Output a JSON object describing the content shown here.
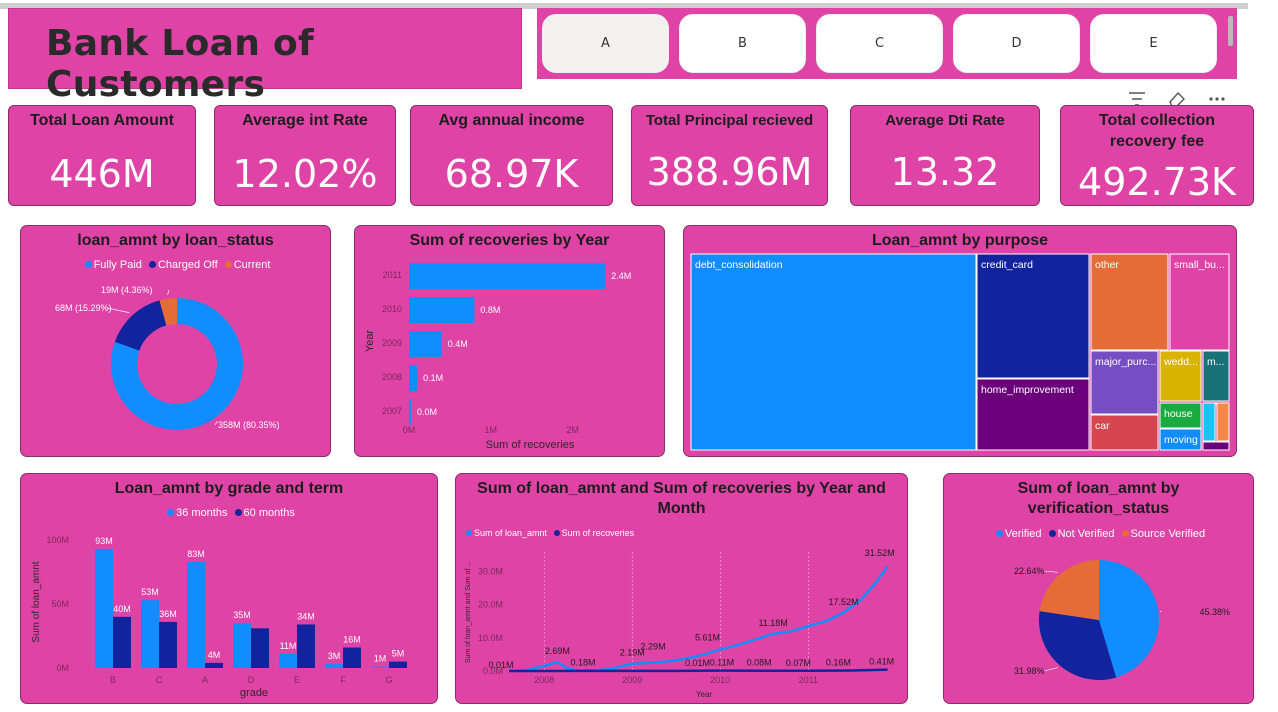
{
  "header": {
    "title": "Bank Loan of  Customers"
  },
  "slicer": {
    "items": [
      "A",
      "B",
      "C",
      "D",
      "E"
    ],
    "selected": "A"
  },
  "toolbar": {
    "icons": [
      "filter-icon",
      "eraser-icon",
      "more-icon"
    ]
  },
  "kpis": [
    {
      "label": "Total Loan Amount",
      "value": "446M"
    },
    {
      "label": "Average int Rate",
      "value": "12.02%"
    },
    {
      "label": "Avg annual income",
      "value": "68.97K"
    },
    {
      "label": "Total Principal recieved",
      "value": "388.96M"
    },
    {
      "label": "Average Dti Rate",
      "value": "13.32"
    },
    {
      "label": "Total collection recovery fee",
      "value": "492.73K"
    }
  ],
  "colors": {
    "background": "#df43a5",
    "blue": "#118dff",
    "navy": "#12239e",
    "red": "#e66c37",
    "pink_card": "#df43a5"
  },
  "chart_data": [
    {
      "type": "pie",
      "title": "loan_amnt by loan_status",
      "labels": [
        "Fully Paid",
        "Charged Off",
        "Current"
      ],
      "values": [
        358,
        68,
        19
      ],
      "data_labels": [
        "358M (80.35%)",
        "68M (15.29%)",
        "19M (4.36%)"
      ],
      "colors": [
        "#118dff",
        "#12239e",
        "#e66c37"
      ],
      "legend_position": "top"
    },
    {
      "type": "bar",
      "title": "Sum of recoveries by Year",
      "categories": [
        "2011",
        "2010",
        "2009",
        "2008",
        "2007"
      ],
      "values": [
        2.4,
        0.8,
        0.4,
        0.1,
        0.0
      ],
      "data_labels": [
        "2.4M",
        "0.8M",
        "0.4M",
        "0.1M",
        "0.0M"
      ],
      "xlabel": "Sum of recoveries",
      "ylabel": "Year",
      "xticks": [
        "0M",
        "1M",
        "2M"
      ],
      "xlim": [
        0,
        2.8
      ],
      "orientation": "horizontal"
    },
    {
      "type": "heatmap",
      "title": "Loan_amnt by purpose",
      "cells": [
        {
          "label": "debt_consolidation",
          "color": "#118dff"
        },
        {
          "label": "credit_card",
          "color": "#12239e"
        },
        {
          "label": "home_improvement",
          "color": "#6b007b"
        },
        {
          "label": "other",
          "color": "#e66c37"
        },
        {
          "label": "small_bu...",
          "color": "#df43a5"
        },
        {
          "label": "major_purc...",
          "color": "#744ec2"
        },
        {
          "label": "wedd...",
          "color": "#d9b300"
        },
        {
          "label": "m...",
          "color": "#197278"
        },
        {
          "label": "car",
          "color": "#d64550"
        },
        {
          "label": "house",
          "color": "#1aab40"
        },
        {
          "label": "moving",
          "color": "#118dff"
        },
        {
          "label": "",
          "color": "#15c6f4"
        },
        {
          "label": "",
          "color": "#f48846"
        },
        {
          "label": "",
          "color": "#6b007b"
        },
        {
          "label": "",
          "color": "#f5d33f"
        }
      ]
    },
    {
      "type": "bar",
      "title": "Loan_amnt by grade and term",
      "categories": [
        "B",
        "C",
        "A",
        "D",
        "E",
        "F",
        "G"
      ],
      "series": [
        {
          "name": "36 months",
          "values": [
            93,
            53,
            83,
            35,
            11,
            3,
            1
          ],
          "labels": [
            "93M",
            "53M",
            "83M",
            "35M",
            "11M",
            "3M",
            "1M"
          ]
        },
        {
          "name": "60 months",
          "values": [
            40,
            36,
            4,
            31,
            34,
            16,
            5
          ],
          "labels": [
            "40M",
            "36M",
            "4M",
            "",
            "34M",
            "16M",
            "5M"
          ]
        }
      ],
      "xlabel": "grade",
      "ylabel": "Sum of loan_amnt",
      "yticks": [
        "0M",
        "50M",
        "100M"
      ],
      "ylim": [
        0,
        100
      ]
    },
    {
      "type": "line",
      "title": "Sum of loan_amnt and Sum of recoveries by Year and Month",
      "xlabel": "Year",
      "ylabel": "Sum of loan_amnt and Sum of ...",
      "xticks": [
        "2008",
        "2009",
        "2010",
        "2011"
      ],
      "yticks": [
        "0.0M",
        "10.0M",
        "20.0M",
        "30.0M"
      ],
      "ylim": [
        0,
        34
      ],
      "series": [
        {
          "name": "Sum of loan_amnt",
          "color": "#118dff",
          "x": [
            2007.6,
            2007.8,
            2008.0,
            2008.15,
            2008.25,
            2008.35,
            2008.6,
            2008.8,
            2009.0,
            2009.1,
            2009.3,
            2009.5,
            2009.7,
            2009.9,
            2010.0,
            2010.2,
            2010.4,
            2010.6,
            2010.8,
            2011.0,
            2011.2,
            2011.4,
            2011.6,
            2011.75,
            2011.9
          ],
          "y": [
            0.01,
            0.3,
            1.5,
            2.69,
            1.0,
            0.2,
            0.18,
            0.9,
            2.19,
            2.29,
            2.6,
            3.2,
            4.2,
            5.61,
            6.5,
            7.8,
            9.5,
            11.18,
            11.9,
            13.5,
            15.0,
            17.52,
            21.5,
            26.0,
            31.52
          ]
        },
        {
          "name": "Sum of recoveries",
          "color": "#12239e",
          "x": [
            2007.6,
            2008.0,
            2008.5,
            2009.0,
            2009.5,
            2010.0,
            2010.5,
            2011.0,
            2011.5,
            2011.9
          ],
          "y": [
            0.01,
            0.01,
            0.02,
            0.05,
            0.05,
            0.11,
            0.08,
            0.07,
            0.16,
            0.41
          ]
        }
      ],
      "data_labels": [
        "0.01M",
        "2.69M",
        "0.18M",
        "2.19M",
        "2.29M",
        "0.01M",
        "5.61M",
        "0.11M",
        "11.18M",
        "0.08M",
        "0.07M",
        "17.52M",
        "0.16M",
        "0.41M",
        "31.52M"
      ]
    },
    {
      "type": "pie",
      "title": "Sum of loan_amnt by verification_status",
      "labels": [
        "Verified",
        "Not Verified",
        "Source Verified"
      ],
      "values": [
        45.38,
        31.98,
        22.64
      ],
      "data_labels": [
        "45.38%",
        "31.98%",
        "22.64%"
      ],
      "colors": [
        "#118dff",
        "#12239e",
        "#e66c37"
      ],
      "legend_position": "top"
    }
  ]
}
